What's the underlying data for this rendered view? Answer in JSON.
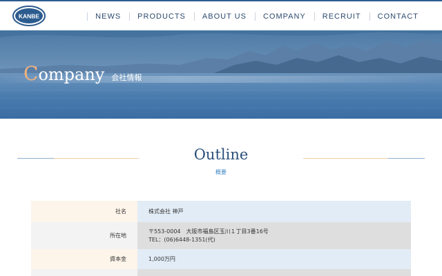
{
  "header": {
    "logo_text": "KANBE",
    "nav": [
      {
        "label": "NEWS"
      },
      {
        "label": "PRODUCTS"
      },
      {
        "label": "ABOUT US"
      },
      {
        "label": "COMPANY"
      },
      {
        "label": "RECRUIT"
      },
      {
        "label": "CONTACT"
      }
    ]
  },
  "hero": {
    "title_initial": "C",
    "title_rest": "ompany",
    "subtitle": "会社情報"
  },
  "section": {
    "title": "Outline",
    "subtitle": "概要"
  },
  "company_table": [
    {
      "label": "社名",
      "lines": [
        "株式会社 神戸"
      ]
    },
    {
      "label": "所在地",
      "lines": [
        "〒553-0004　大阪市福島区玉川１丁目3番16号",
        "TEL：(06)6448-1351(代)"
      ]
    },
    {
      "label": "資本金",
      "lines": [
        "1,000万円"
      ]
    },
    {
      "label": "",
      "lines": [
        ""
      ]
    }
  ],
  "colors": {
    "brand_blue": "#2c5c8f",
    "accent_orange": "#f2b27d",
    "heading_blue": "#2a4f7a"
  }
}
